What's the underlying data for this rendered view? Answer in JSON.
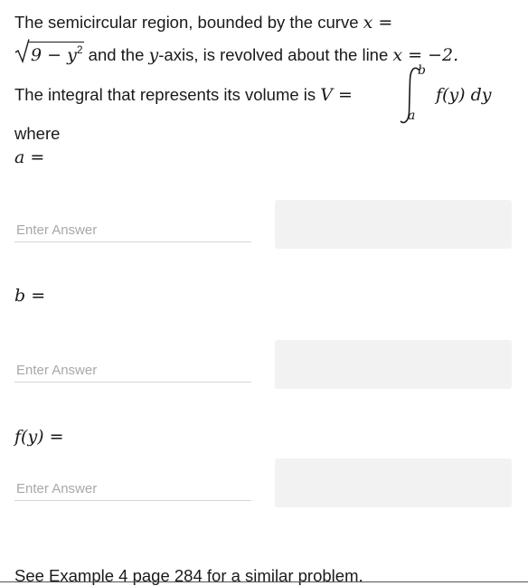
{
  "question": {
    "line1_text": "The semicircular region, bounded by the curve ",
    "line1_math": "x =",
    "sqrt_content": "9 − y",
    "sqrt_exponent": "2",
    "line2_text": " and the ",
    "line2_var": "y",
    "line2_text2": "-axis, is revolved about the line ",
    "line2_math": "x = −2.",
    "line3_text": "The integral that represents its volume is ",
    "line3_math": "V =",
    "integral_upper": "b",
    "integral_lower": "a",
    "integrand": "f(y) dy",
    "where_text": "where"
  },
  "answers": [
    {
      "label_var": "a",
      "label_eq": " =",
      "placeholder": "Enter Answer"
    },
    {
      "label_var": "b",
      "label_eq": " =",
      "placeholder": "Enter Answer"
    },
    {
      "label_var": "f(y)",
      "label_eq": " =",
      "placeholder": "Enter Answer"
    }
  ],
  "footer": {
    "reference_text": "See Example 4 page 284 for a similar problem."
  }
}
